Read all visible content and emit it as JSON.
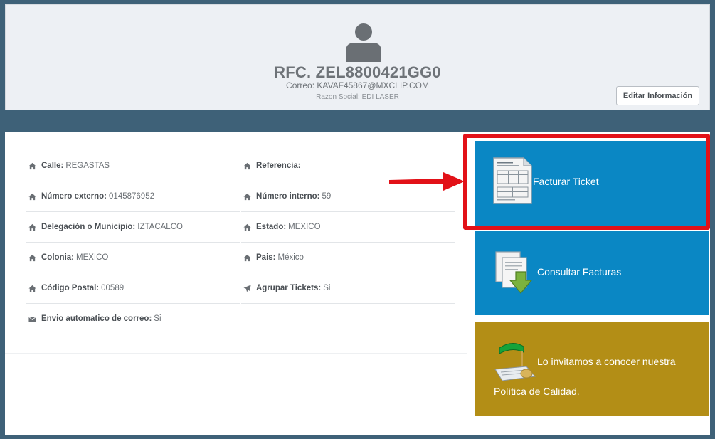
{
  "profile": {
    "rfc": "RFC. ZEL8800421GG0",
    "correo": "Correo: KAVAF45867@MXCLIP.COM",
    "razon_social": "Razon Social: EDI LASER",
    "edit_button": "Editar Información"
  },
  "details": {
    "left": [
      {
        "label": "Calle:",
        "value": "REGASTAS",
        "icon": "home-icon"
      },
      {
        "label": "Número externo:",
        "value": "0145876952",
        "icon": "home-icon"
      },
      {
        "label": "Delegación o Municipio:",
        "value": "IZTACALCO",
        "icon": "home-icon"
      },
      {
        "label": "Colonia:",
        "value": "MEXICO",
        "icon": "home-icon"
      },
      {
        "label": "Código Postal:",
        "value": "00589",
        "icon": "home-icon"
      },
      {
        "label": "Envio automatico de correo:",
        "value": "Si",
        "icon": "envelope-icon"
      }
    ],
    "right": [
      {
        "label": "Referencia:",
        "value": "",
        "icon": "home-icon"
      },
      {
        "label": "Número interno:",
        "value": "59",
        "icon": "home-icon"
      },
      {
        "label": "Estado:",
        "value": "MEXICO",
        "icon": "home-icon"
      },
      {
        "label": "Pais:",
        "value": "México",
        "icon": "home-icon"
      },
      {
        "label": "Agrupar Tickets:",
        "value": "Si",
        "icon": "plane-icon"
      }
    ]
  },
  "tiles": {
    "facturar": "Facturar Ticket",
    "consultar": "Consultar Facturas",
    "politica_line1": "Lo invitamos a conocer nuestra",
    "politica_line2": "Política de Calidad."
  },
  "colors": {
    "page_bg": "#3e6178",
    "tile_blue": "#0a87c4",
    "tile_gold": "#b38e16",
    "highlight_red": "#e21118"
  }
}
